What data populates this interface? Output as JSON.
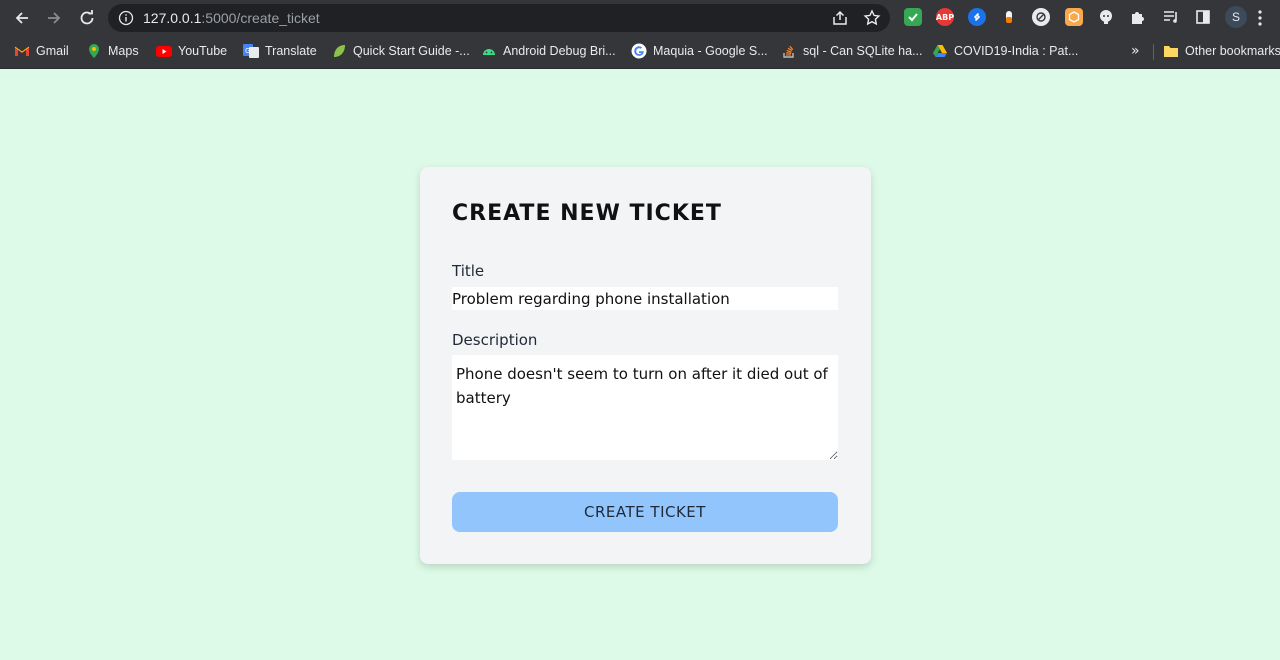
{
  "browser": {
    "url_host": "127.0.0.1",
    "url_path": ":5000/create_ticket",
    "profile_initial": "S",
    "bookmarks": [
      {
        "label": "Gmail",
        "icon": "gmail-icon"
      },
      {
        "label": "Maps",
        "icon": "maps-icon"
      },
      {
        "label": "YouTube",
        "icon": "youtube-icon"
      },
      {
        "label": "Translate",
        "icon": "translate-icon"
      },
      {
        "label": "Quick Start Guide -...",
        "icon": "leaf-icon"
      },
      {
        "label": "Android Debug Bri...",
        "icon": "android-icon"
      },
      {
        "label": "Maquia - Google S...",
        "icon": "google-icon"
      },
      {
        "label": "sql - Can SQLite ha...",
        "icon": "stackoverflow-icon"
      },
      {
        "label": "COVID19-India : Pat...",
        "icon": "drive-icon"
      }
    ],
    "bookmarks_more": "»",
    "other_bookmarks": "Other bookmarks",
    "extensions": [
      {
        "name": "check-extension-icon",
        "color": "#34a853",
        "text": ""
      },
      {
        "name": "adblock-plus-icon",
        "color": "#e53935",
        "text": "ABP"
      },
      {
        "name": "shazam-icon",
        "color": "#1a73e8",
        "text": ""
      },
      {
        "name": "color-picker-icon",
        "color": "#f5f5f5",
        "text": ""
      },
      {
        "name": "no-tracking-icon",
        "color": "#e8eaed",
        "text": ""
      },
      {
        "name": "orange-extension-icon",
        "color": "#f9a94b",
        "text": ""
      },
      {
        "name": "github-icon",
        "color": "#e8eaed",
        "text": ""
      }
    ]
  },
  "form": {
    "heading": "CREATE NEW TICKET",
    "title_label": "Title",
    "title_value": "Problem regarding phone installation",
    "description_label": "Description",
    "description_value": "Phone doesn't seem to turn on after it died out of battery",
    "submit_label": "CREATE TICKET"
  },
  "colors": {
    "page_background": "#dcfae7",
    "card_background": "#f3f4f6",
    "button_background": "#93c5fd"
  }
}
